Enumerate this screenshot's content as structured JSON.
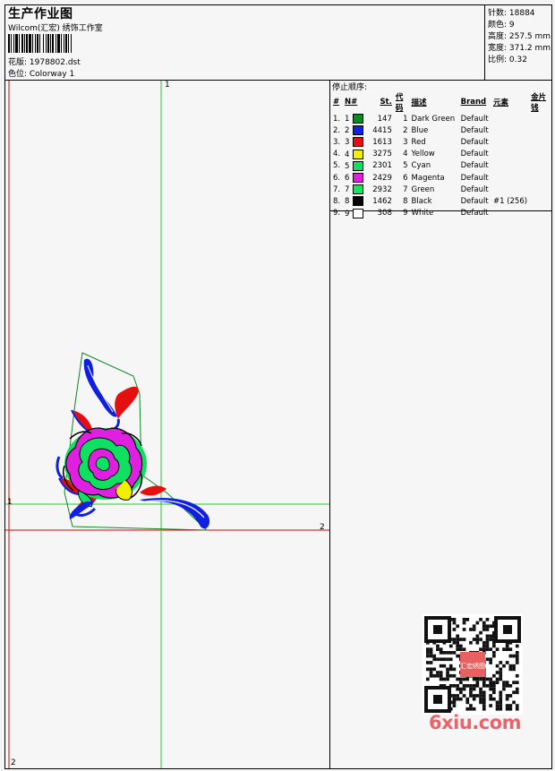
{
  "header": {
    "title": "生产作业图",
    "company": "Wilcom(汇宏) 绣饰工作室",
    "design_label": "花版: 1978802.dst",
    "colorway_label": "色位: Colorway 1"
  },
  "stats": {
    "stitches": "针数: 18884",
    "colors": "颜色: 9",
    "height": "高度: 257.5 mm",
    "width": "宽度: 371.2 mm",
    "scale": "比例: 0.32"
  },
  "stop_sequence": {
    "title": "停止顺序:",
    "headers": [
      "#",
      "N#",
      "St.",
      "代码",
      "描述",
      "Brand",
      "元素",
      "金片钱"
    ],
    "rows": [
      {
        "idx": "1.",
        "n": "1",
        "color": "#0a8a1e",
        "st": "147",
        "code": "1",
        "desc": "Dark Green",
        "brand": "Default",
        "elem": ""
      },
      {
        "idx": "2.",
        "n": "2",
        "color": "#1020e0",
        "st": "4415",
        "code": "2",
        "desc": "Blue",
        "brand": "Default",
        "elem": ""
      },
      {
        "idx": "3.",
        "n": "3",
        "color": "#e41010",
        "st": "1613",
        "code": "3",
        "desc": "Red",
        "brand": "Default",
        "elem": ""
      },
      {
        "idx": "4.",
        "n": "4",
        "color": "#f0f000",
        "st": "3275",
        "code": "4",
        "desc": "Yellow",
        "brand": "Default",
        "elem": ""
      },
      {
        "idx": "5.",
        "n": "5",
        "color": "#10e060",
        "st": "2301",
        "code": "5",
        "desc": "Cyan",
        "brand": "Default",
        "elem": ""
      },
      {
        "idx": "6.",
        "n": "6",
        "color": "#e020e0",
        "st": "2429",
        "code": "6",
        "desc": "Magenta",
        "brand": "Default",
        "elem": ""
      },
      {
        "idx": "7.",
        "n": "7",
        "color": "#10e860",
        "st": "2932",
        "code": "7",
        "desc": "Green",
        "brand": "Default",
        "elem": ""
      },
      {
        "idx": "8.",
        "n": "8",
        "color": "#000000",
        "st": "1462",
        "code": "8",
        "desc": "Black",
        "brand": "Default",
        "elem": "#1 (256)"
      },
      {
        "idx": "9.",
        "n": "9",
        "color": "#ffffff",
        "st": "308",
        "code": "9",
        "desc": "White",
        "brand": "Default",
        "elem": ""
      }
    ]
  },
  "canvas": {
    "axis_top_label": "1",
    "axis_left_label": "1",
    "axis_right_label": "2",
    "axis_bottom_label": "2"
  },
  "watermark": {
    "text": "6xiu.com",
    "qr_center_text": "汇宏绣图"
  }
}
